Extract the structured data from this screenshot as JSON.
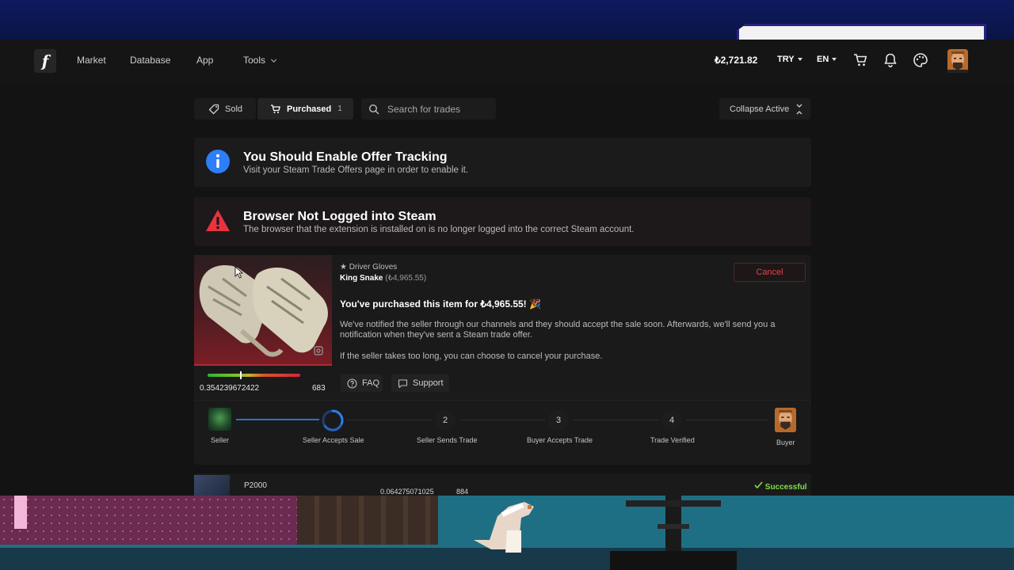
{
  "nav": {
    "logo": "f",
    "links": [
      "Market",
      "Database",
      "App",
      "Tools"
    ],
    "balance": "₺2,721.82",
    "currency": "TRY",
    "language": "EN"
  },
  "tabs": {
    "sold": "Sold",
    "purchased": "Purchased",
    "purchased_count": "1",
    "search_placeholder": "Search for trades",
    "collapse": "Collapse Active"
  },
  "alerts": {
    "info_title": "You Should Enable Offer Tracking",
    "info_sub": "Visit your Steam Trade Offers page in order to enable it.",
    "warn_title": "Browser Not Logged into Steam",
    "warn_sub": "The browser that the extension is installed on is no longer logged into the correct Steam account."
  },
  "trade": {
    "item_type": "★ Driver Gloves",
    "item_name": "King Snake",
    "item_price": "(₺4,965.55)",
    "float": "0.354239672422",
    "pattern": "683",
    "wear_fraction": 0.354,
    "cancel": "Cancel",
    "purchased_msg": "You've purchased this item for ₺4,965.55! 🎉",
    "notify_msg": "We've notified the seller through our channels and they should accept the sale soon. Afterwards, we'll send you a notification when they've sent a Steam trade offer.",
    "cancel_msg": "If the seller takes too long, you can choose to cancel your purchase.",
    "faq": "FAQ",
    "support": "Support"
  },
  "steps": {
    "seller": "Seller",
    "buyer": "Buyer",
    "items": [
      {
        "num": "",
        "label": "Seller Accepts Sale"
      },
      {
        "num": "2",
        "label": "Seller Sends Trade"
      },
      {
        "num": "3",
        "label": "Buyer Accepts Trade"
      },
      {
        "num": "4",
        "label": "Trade Verified"
      }
    ]
  },
  "row2": {
    "item_name": "P2000",
    "float": "0.064275071025",
    "pattern": "884",
    "status": "Successful"
  },
  "colors": {
    "accent_blue": "#2c6fd6",
    "danger": "#e0434f",
    "success": "#7fe04a"
  }
}
